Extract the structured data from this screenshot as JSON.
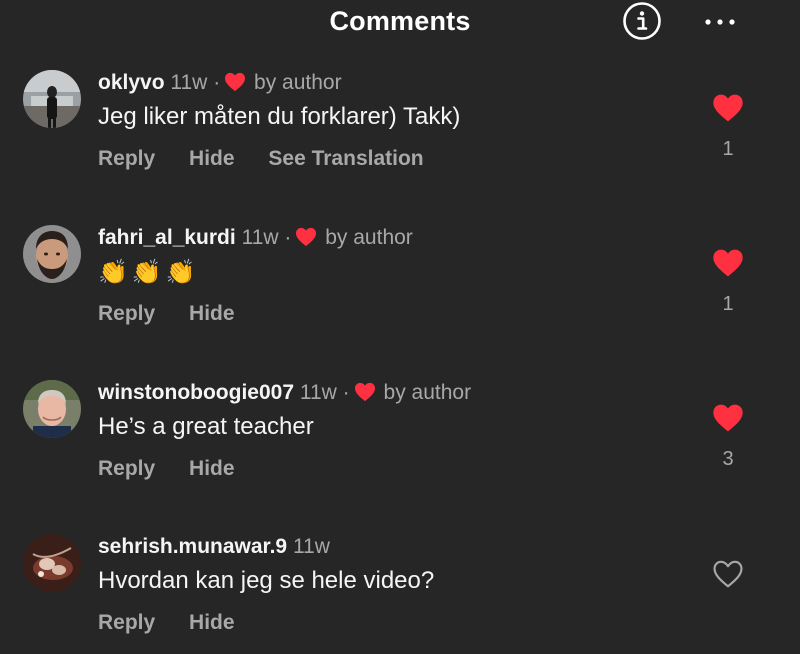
{
  "header": {
    "title": "Comments",
    "info_icon": "info-circle-icon",
    "more_icon": "more-horizontal-icon"
  },
  "colors": {
    "background": "#262626",
    "heart_red": "#ff3040",
    "muted_text": "#a8a8a8",
    "primary_text": "#f5f5f5"
  },
  "comments": [
    {
      "username": "oklyvo",
      "time": "11w",
      "separator": "·",
      "liked_by_author": true,
      "by_author_label": "by author",
      "text": "Jeg liker måten du forklarer) Takk)",
      "actions": {
        "reply": "Reply",
        "hide": "Hide",
        "translate": "See Translation"
      },
      "liked": true,
      "like_count": "1"
    },
    {
      "username": "fahri_al_kurdi",
      "time": "11w",
      "separator": "·",
      "liked_by_author": true,
      "by_author_label": "by author",
      "text": "👏👏👏",
      "actions": {
        "reply": "Reply",
        "hide": "Hide"
      },
      "liked": true,
      "like_count": "1"
    },
    {
      "username": "winstonoboogie007",
      "time": "11w",
      "separator": "·",
      "liked_by_author": true,
      "by_author_label": "by author",
      "text": "He’s a great teacher",
      "actions": {
        "reply": "Reply",
        "hide": "Hide"
      },
      "liked": true,
      "like_count": "3"
    },
    {
      "username": "sehrish.munawar.9",
      "time": "11w",
      "liked_by_author": false,
      "text": "Hvordan kan jeg se hele video?",
      "actions": {
        "reply": "Reply",
        "hide": "Hide"
      },
      "liked": false
    }
  ]
}
